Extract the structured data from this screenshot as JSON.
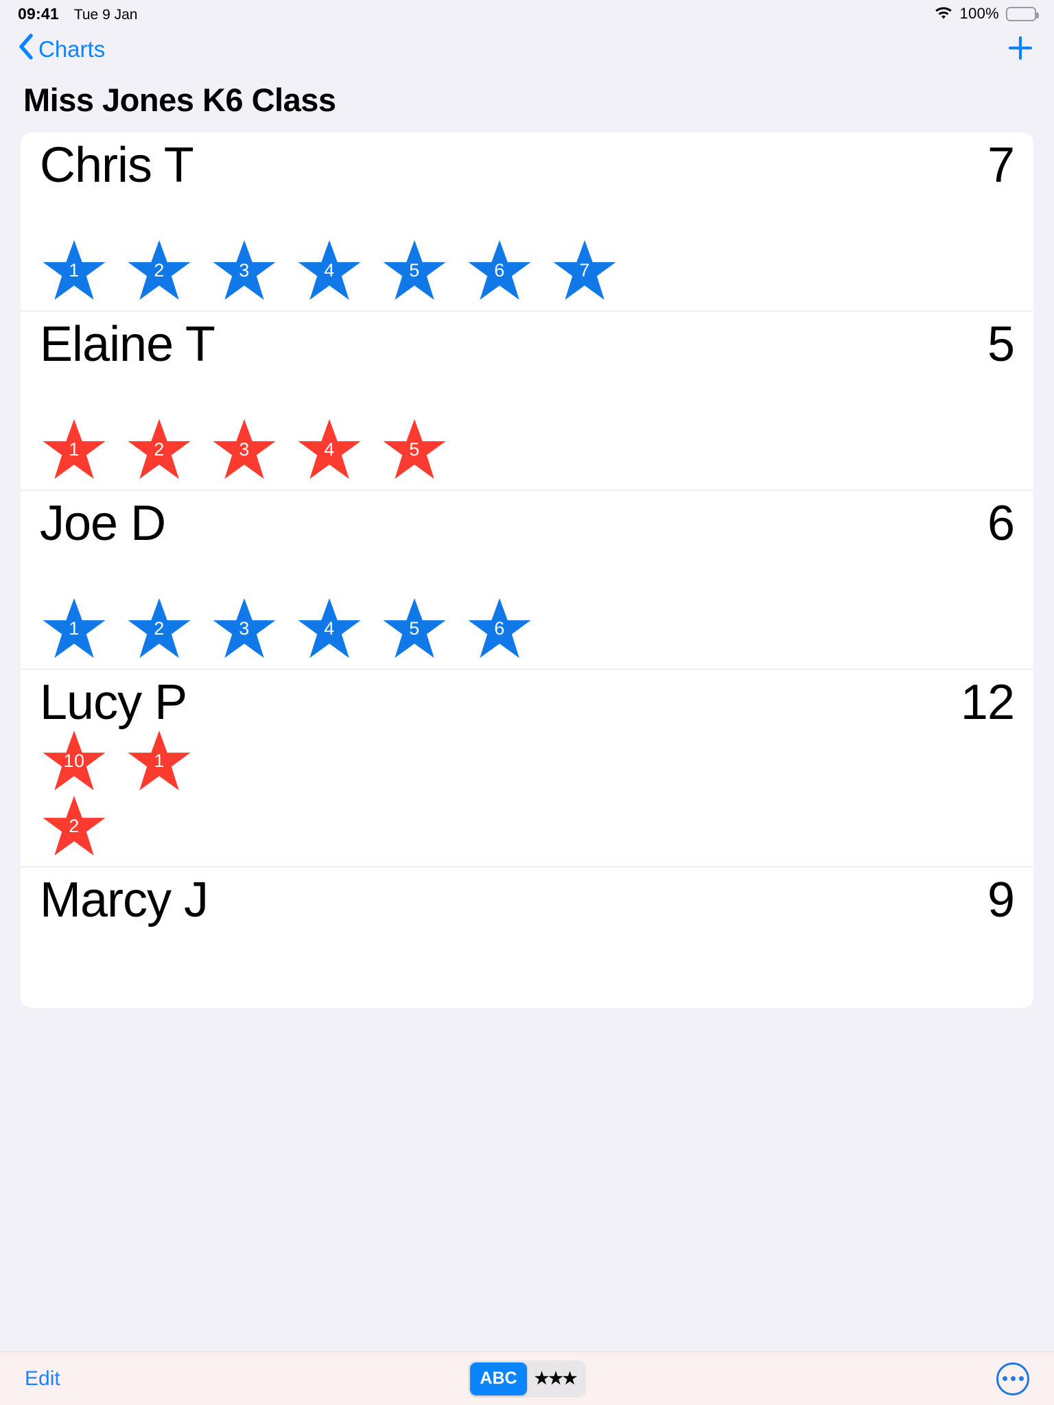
{
  "statusbar": {
    "time": "09:41",
    "date": "Tue 9 Jan",
    "battery_percent": "100%",
    "wifi_icon": "wifi-icon",
    "battery_icon": "battery-full-icon"
  },
  "navbar": {
    "back_label": "Charts",
    "back_icon": "chevron-left-icon",
    "add_icon": "plus-icon"
  },
  "page_title": "Miss Jones K6 Class",
  "colors": {
    "accent_blue": "#0a84ff",
    "star_blue": "#1178e8",
    "star_red": "#fb3b30",
    "background": "#f1f1f7",
    "card": "#ffffff"
  },
  "students": [
    {
      "name": "Chris T",
      "score": "7",
      "star_color": "#1178e8",
      "stars": [
        "1",
        "2",
        "3",
        "4",
        "5",
        "6",
        "7"
      ]
    },
    {
      "name": "Elaine T",
      "score": "5",
      "star_color": "#fb3b30",
      "stars": [
        "1",
        "2",
        "3",
        "4",
        "5"
      ]
    },
    {
      "name": "Joe D",
      "score": "6",
      "star_color": "#1178e8",
      "stars": [
        "1",
        "2",
        "3",
        "4",
        "5",
        "6"
      ]
    },
    {
      "name": "Lucy P",
      "score": "12",
      "star_color": "#fb3b30",
      "stars": [
        "10",
        "1",
        "2"
      ]
    },
    {
      "name": "Marcy J",
      "score": "9",
      "star_color": "#fb3b30",
      "stars": []
    }
  ],
  "toolbar": {
    "edit_label": "Edit",
    "segment_abc": "ABC",
    "segment_stars": "★★★",
    "segment_selected": "ABC",
    "more_icon": "ellipsis-circle-icon"
  }
}
